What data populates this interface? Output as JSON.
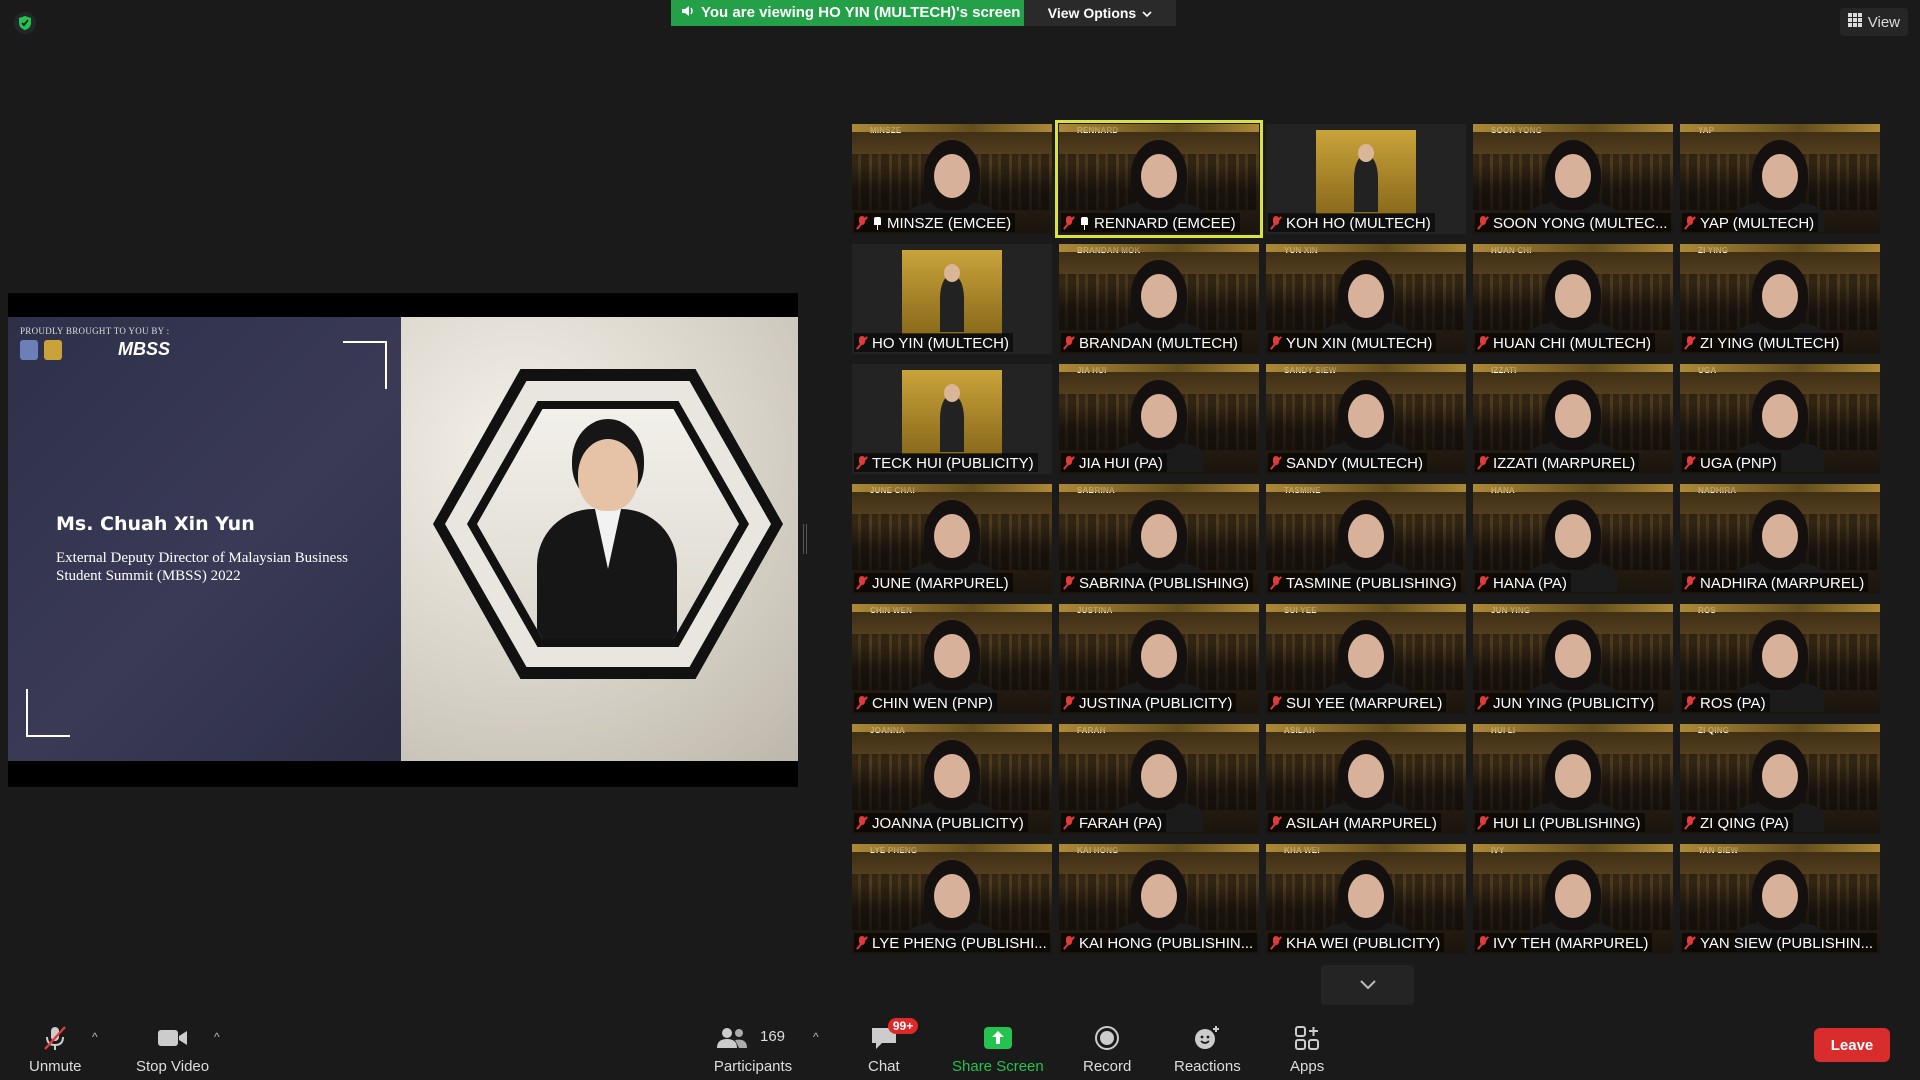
{
  "top": {
    "banner_text": "You are viewing HO YIN (MULTECH)'s screen",
    "view_options": "View Options",
    "view_button": "View"
  },
  "slide": {
    "brought_by": "PROUDLY BROUGHT TO YOU BY :",
    "logo_text": "MBSS",
    "speaker_name": "Ms. Chuah Xin Yun",
    "speaker_role": "External Deputy Director of Malaysian Business Student Summit (MBSS) 2022"
  },
  "participants": [
    {
      "tag": "MINSZE",
      "name": "MINSZE (EMCEE)",
      "pinned": true,
      "bg": "city"
    },
    {
      "tag": "RENNARD",
      "name": "RENNARD (EMCEE)",
      "pinned": true,
      "bg": "city",
      "active": true
    },
    {
      "tag": "",
      "name": "KOH HO (MULTECH)",
      "bg": "poster"
    },
    {
      "tag": "SOON YONG",
      "name": "SOON YONG (MULTEC...",
      "bg": "city"
    },
    {
      "tag": "YAP",
      "name": "YAP (MULTECH)",
      "bg": "city"
    },
    {
      "tag": "",
      "name": "HO YIN (MULTECH)",
      "bg": "poster"
    },
    {
      "tag": "BRANDAN MOK",
      "name": "BRANDAN (MULTECH)",
      "bg": "city"
    },
    {
      "tag": "YUN XIN",
      "name": "YUN XIN (MULTECH)",
      "bg": "city"
    },
    {
      "tag": "HUAN CHI",
      "name": "HUAN CHI (MULTECH)",
      "bg": "city"
    },
    {
      "tag": "ZI YING",
      "name": "ZI YING (MULTECH)",
      "bg": "city"
    },
    {
      "tag": "",
      "name": "TECK HUI (PUBLICITY)",
      "bg": "poster"
    },
    {
      "tag": "JIA HUI",
      "name": "JIA HUI (PA)",
      "bg": "city"
    },
    {
      "tag": "SANDY SIEW",
      "name": "SANDY (MULTECH)",
      "bg": "city"
    },
    {
      "tag": "IZZATI",
      "name": "IZZATI (MARPUREL)",
      "bg": "city"
    },
    {
      "tag": "UGA",
      "name": "UGA (PNP)",
      "bg": "city"
    },
    {
      "tag": "JUNE CHAI",
      "name": "JUNE (MARPUREL)",
      "bg": "city"
    },
    {
      "tag": "SABRINA",
      "name": "SABRINA (PUBLISHING)",
      "bg": "city"
    },
    {
      "tag": "TASMINE",
      "name": "TASMINE (PUBLISHING)",
      "bg": "city"
    },
    {
      "tag": "HANA",
      "name": "HANA (PA)",
      "bg": "city"
    },
    {
      "tag": "NADHIRA",
      "name": "NADHIRA (MARPUREL)",
      "bg": "city"
    },
    {
      "tag": "CHIN WEN",
      "name": "CHIN WEN (PNP)",
      "bg": "city"
    },
    {
      "tag": "JUSTINA",
      "name": "JUSTINA (PUBLICITY)",
      "bg": "city"
    },
    {
      "tag": "SUI YEE",
      "name": "SUI YEE (MARPUREL)",
      "bg": "city"
    },
    {
      "tag": "JUN YING",
      "name": "JUN YING (PUBLICITY)",
      "bg": "city"
    },
    {
      "tag": "ROS",
      "name": "ROS (PA)",
      "bg": "city"
    },
    {
      "tag": "JOANNA",
      "name": "JOANNA (PUBLICITY)",
      "bg": "city"
    },
    {
      "tag": "FARAH",
      "name": "FARAH (PA)",
      "bg": "city"
    },
    {
      "tag": "ASILAH",
      "name": "ASILAH (MARPUREL)",
      "bg": "city"
    },
    {
      "tag": "HUI LI",
      "name": "HUI LI (PUBLISHING)",
      "bg": "city"
    },
    {
      "tag": "ZI QING",
      "name": "ZI QING (PA)",
      "bg": "city"
    },
    {
      "tag": "LYE PHENG",
      "name": "LYE PHENG (PUBLISHI...",
      "bg": "city"
    },
    {
      "tag": "KAI HONG",
      "name": "KAI HONG (PUBLISHIN...",
      "bg": "city"
    },
    {
      "tag": "KHA WEI",
      "name": "KHA WEI (PUBLICITY)",
      "bg": "city"
    },
    {
      "tag": "IVY",
      "name": "IVY TEH (MARPUREL)",
      "bg": "city"
    },
    {
      "tag": "YAN SIEW",
      "name": "YAN SIEW (PUBLISHIN...",
      "bg": "city"
    }
  ],
  "toolbar": {
    "unmute": "Unmute",
    "stop_video": "Stop Video",
    "participants": "Participants",
    "participants_count": "169",
    "chat": "Chat",
    "chat_badge": "99+",
    "share_screen": "Share Screen",
    "record": "Record",
    "reactions": "Reactions",
    "apps": "Apps",
    "leave": "Leave"
  },
  "colors": {
    "banner_green": "#24a148",
    "leave_red": "#d92d2d",
    "active_speaker": "#d9e33c",
    "share_green": "#24c24e"
  }
}
